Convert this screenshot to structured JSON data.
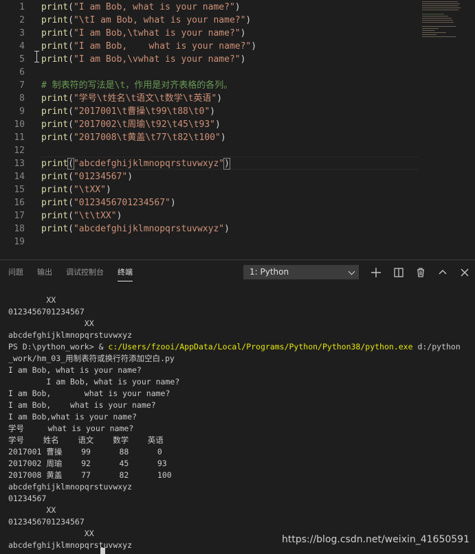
{
  "editor": {
    "lines": [
      {
        "n": "1",
        "parts": [
          {
            "t": "print",
            "c": "fn"
          },
          {
            "t": "(",
            "c": "pu"
          },
          {
            "t": "\"I am Bob, what is your name?\"",
            "c": "st"
          },
          {
            "t": ")",
            "c": "pu"
          }
        ]
      },
      {
        "n": "2",
        "parts": [
          {
            "t": "print",
            "c": "fn"
          },
          {
            "t": "(",
            "c": "pu"
          },
          {
            "t": "\"\\tI am Bob, what is your name?\"",
            "c": "st"
          },
          {
            "t": ")",
            "c": "pu"
          }
        ]
      },
      {
        "n": "3",
        "parts": [
          {
            "t": "print",
            "c": "fn"
          },
          {
            "t": "(",
            "c": "pu"
          },
          {
            "t": "\"I am Bob,\\twhat is your name?\"",
            "c": "st"
          },
          {
            "t": ")",
            "c": "pu"
          }
        ]
      },
      {
        "n": "4",
        "parts": [
          {
            "t": "print",
            "c": "fn"
          },
          {
            "t": "(",
            "c": "pu"
          },
          {
            "t": "\"I am Bob,    what is your name?\"",
            "c": "st"
          },
          {
            "t": ")",
            "c": "pu"
          }
        ]
      },
      {
        "n": "5",
        "parts": [
          {
            "t": "print",
            "c": "fn"
          },
          {
            "t": "(",
            "c": "pu"
          },
          {
            "t": "\"I am Bob,\\vwhat is your name?\"",
            "c": "st"
          },
          {
            "t": ")",
            "c": "pu"
          }
        ]
      },
      {
        "n": "6",
        "parts": []
      },
      {
        "n": "7",
        "parts": [
          {
            "t": "# 制表符的写法是\\t，作用是对齐表格的各列。",
            "c": "cm"
          }
        ]
      },
      {
        "n": "8",
        "parts": [
          {
            "t": "print",
            "c": "fn"
          },
          {
            "t": "(",
            "c": "pu"
          },
          {
            "t": "\"学号\\t姓名\\t语文\\t数学\\t英语\"",
            "c": "st"
          },
          {
            "t": ")",
            "c": "pu"
          }
        ]
      },
      {
        "n": "9",
        "parts": [
          {
            "t": "print",
            "c": "fn"
          },
          {
            "t": "(",
            "c": "pu"
          },
          {
            "t": "\"2017001\\t曹操\\t99\\t88\\t0\"",
            "c": "st"
          },
          {
            "t": ")",
            "c": "pu"
          }
        ]
      },
      {
        "n": "10",
        "parts": [
          {
            "t": "print",
            "c": "fn"
          },
          {
            "t": "(",
            "c": "pu"
          },
          {
            "t": "\"2017002\\t周瑜\\t92\\t45\\t93\"",
            "c": "st"
          },
          {
            "t": ")",
            "c": "pu"
          }
        ]
      },
      {
        "n": "11",
        "parts": [
          {
            "t": "print",
            "c": "fn"
          },
          {
            "t": "(",
            "c": "pu"
          },
          {
            "t": "\"2017008\\t黄盖\\t77\\t82\\t100\"",
            "c": "st"
          },
          {
            "t": ")",
            "c": "pu"
          }
        ]
      },
      {
        "n": "12",
        "parts": []
      },
      {
        "n": "13",
        "parts": [
          {
            "t": "print",
            "c": "fn"
          },
          {
            "t": "(",
            "c": "pu bm"
          },
          {
            "t": "\"abcdefghijklmnopqrstuvwxyz\"",
            "c": "st"
          },
          {
            "t": ")",
            "c": "pu bm"
          }
        ]
      },
      {
        "n": "14",
        "parts": [
          {
            "t": "print",
            "c": "fn"
          },
          {
            "t": "(",
            "c": "pu"
          },
          {
            "t": "\"01234567\"",
            "c": "st"
          },
          {
            "t": ")",
            "c": "pu"
          }
        ]
      },
      {
        "n": "15",
        "parts": [
          {
            "t": "print",
            "c": "fn"
          },
          {
            "t": "(",
            "c": "pu"
          },
          {
            "t": "\"\\tXX\"",
            "c": "st"
          },
          {
            "t": ")",
            "c": "pu"
          }
        ]
      },
      {
        "n": "16",
        "parts": [
          {
            "t": "print",
            "c": "fn"
          },
          {
            "t": "(",
            "c": "pu"
          },
          {
            "t": "\"0123456701234567\"",
            "c": "st"
          },
          {
            "t": ")",
            "c": "pu"
          }
        ]
      },
      {
        "n": "17",
        "parts": [
          {
            "t": "print",
            "c": "fn"
          },
          {
            "t": "(",
            "c": "pu"
          },
          {
            "t": "\"\\t\\tXX\"",
            "c": "st"
          },
          {
            "t": ")",
            "c": "pu"
          }
        ]
      },
      {
        "n": "18",
        "parts": [
          {
            "t": "print",
            "c": "fn"
          },
          {
            "t": "(",
            "c": "pu"
          },
          {
            "t": "\"abcdefghijklmnopqrstuvwxyz\"",
            "c": "st"
          },
          {
            "t": ")",
            "c": "pu"
          }
        ]
      },
      {
        "n": "19",
        "parts": []
      }
    ]
  },
  "panel": {
    "tabs": {
      "problems": "问题",
      "output": "输出",
      "debug_console": "调试控制台",
      "terminal": "终端"
    },
    "terminal_select": "1: Python",
    "icons": [
      "plus-icon",
      "split-terminal-icon",
      "trash-icon",
      "chevron-up-icon",
      "close-icon"
    ]
  },
  "terminal": {
    "lines": [
      "        XX",
      "0123456701234567",
      "                XX",
      "abcdefghijklmnopqrstuvwxyz",
      "",
      "_work/hm_03_用制表符或换行符添加空白.py",
      "I am Bob, what is your name?",
      "        I am Bob, what is your name?",
      "I am Bob,       what is your name?",
      "I am Bob,    what is your name?",
      "I am Bob,what is your name?",
      "学号     what is your name?",
      "学号    姓名    语文    数学    英语",
      "2017001 曹操    99      88      0",
      "2017002 周瑜    92      45      93",
      "2017008 黄盖    77      82      100",
      "abcdefghijklmnopqrstuvwxyz",
      "01234567",
      "        XX",
      "0123456701234567",
      "                XX",
      "abcdefghijklmnopqrstuvwxyz"
    ],
    "prompt": "PS D:\\python_work> & ",
    "exe_path": "c:/Users/fzooi/AppData/Local/Programs/Python/Python38/python.exe",
    "script_arg": " d:/python"
  },
  "watermark": "https://blog.csdn.net/weixin_41650591"
}
